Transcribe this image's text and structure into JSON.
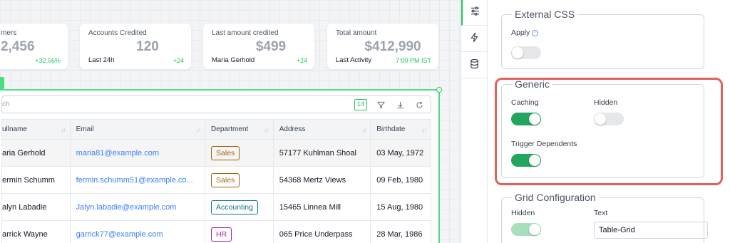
{
  "stats": [
    {
      "title": "mers",
      "value": "2,456",
      "sub": "",
      "delta": "+32.56%"
    },
    {
      "title": "Accounts Credited",
      "value": "120",
      "sub": "Last 24h",
      "delta": "+24"
    },
    {
      "title": "Last amount credited",
      "value": "$499",
      "sub": "Maria Gerhold",
      "delta": "+24"
    },
    {
      "title": "Total amount",
      "value": "$412,990",
      "sub": "Last Activity",
      "delta": "7:00 PM IST"
    }
  ],
  "table": {
    "search_placeholder": "ch",
    "count_badge": "14",
    "columns": [
      "ullname",
      "Email",
      "Department",
      "Address",
      "Birthdate"
    ],
    "rows": [
      {
        "name": "aria Gerhold",
        "email": "maria81@example.com",
        "dept": "Sales",
        "address": "57177 Kuhlman Shoal",
        "birth": "03 May, 1972"
      },
      {
        "name": "ermin Schumm",
        "email": "fermin.schumm51@example.co...",
        "dept": "Sales",
        "address": "54368 Mertz Views",
        "birth": "09 Feb, 1980"
      },
      {
        "name": "alyn Labadie",
        "email": "Jalyn.labadie@example.com",
        "dept": "Accounting",
        "address": "15465 Linnea Mill",
        "birth": "15 Aug, 1980"
      },
      {
        "name": "arrick Wayne",
        "email": "garrick77@example.com",
        "dept": "HR",
        "address": "065 Price Underpass",
        "birth": "28 Mar, 1986"
      }
    ]
  },
  "dept_colors": {
    "Sales": "#a16207",
    "Accounting": "#0e7490",
    "HR": "#a21caf"
  },
  "sidebar_icons": [
    "sliders-icon",
    "lightning-icon",
    "database-icon"
  ],
  "panel": {
    "external_css": {
      "title": "External CSS",
      "apply_label": "Apply",
      "apply_on": false
    },
    "generic": {
      "title": "Generic",
      "caching_label": "Caching",
      "caching_on": true,
      "hidden_label": "Hidden",
      "hidden_on": false,
      "trigger_label": "Trigger Dependents",
      "trigger_on": true
    },
    "grid_config": {
      "title": "Grid Configuration",
      "hidden_label": "Hidden",
      "hidden_on": true,
      "text_label": "Text",
      "text_value": "Table-Grid"
    }
  },
  "colors": {
    "accent": "#22c55e",
    "highlight": "#e0625c",
    "link": "#3b82f6"
  }
}
